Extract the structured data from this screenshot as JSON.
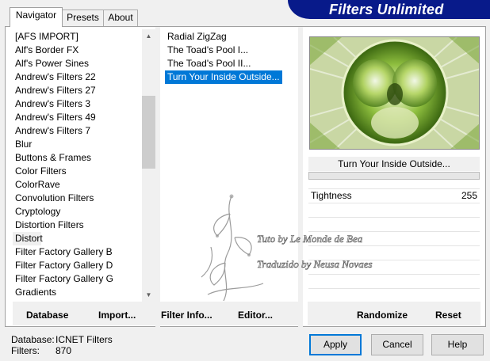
{
  "brand": "Filters Unlimited",
  "tabs": [
    {
      "label": "Navigator"
    },
    {
      "label": "Presets"
    },
    {
      "label": "About"
    }
  ],
  "categories": [
    "[AFS IMPORT]",
    "Alf's Border FX",
    "Alf's Power Sines",
    "Andrew's Filters 22",
    "Andrew's Filters 27",
    "Andrew's Filters 3",
    "Andrew's Filters 49",
    "Andrew's Filters 7",
    "Blur",
    "Buttons & Frames",
    "Color Filters",
    "ColorRave",
    "Convolution Filters",
    "Cryptology",
    "Distortion Filters",
    "Distort",
    "Filter Factory Gallery B",
    "Filter Factory Gallery D",
    "Filter Factory Gallery G",
    "Gradients"
  ],
  "current_category": "Distort",
  "filters": [
    "Radial ZigZag",
    "The Toad's Pool I...",
    "The Toad's Pool II...",
    "Turn Your Inside Outside..."
  ],
  "selected_filter": "Turn Your Inside Outside...",
  "preview": {
    "filter_name": "Turn Your Inside Outside...",
    "params": [
      {
        "label": "Tightness",
        "value": "255"
      }
    ]
  },
  "buttons": {
    "database": "Database",
    "import": "Import...",
    "filter_info": "Filter Info...",
    "editor": "Editor...",
    "randomize": "Randomize",
    "reset": "Reset",
    "apply": "Apply",
    "cancel": "Cancel",
    "help": "Help"
  },
  "footer": {
    "database_label": "Database:",
    "database_value": "ICNET Filters",
    "filters_label": "Filters:",
    "filters_value": "870"
  },
  "watermark": {
    "line1": "Tuto by Le Monde de Bea",
    "line2": "Traduzido by Neusa Novaes"
  },
  "colors": {
    "brand_bg": "#081a8a",
    "selection": "#0078d7",
    "preview_green": "#8fbf3f"
  }
}
